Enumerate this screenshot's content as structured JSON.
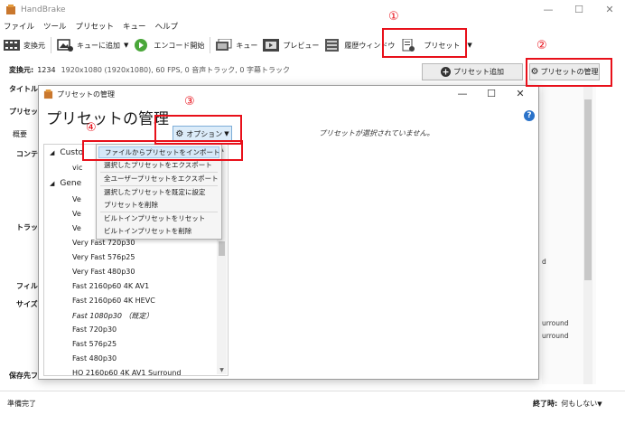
{
  "app": {
    "title": "HandBrake"
  },
  "menubar": [
    "ファイル",
    "ツール",
    "プリセット",
    "キュー",
    "ヘルプ"
  ],
  "toolbar": {
    "source": "変換元",
    "add_to_queue": "キューに追加",
    "start_encode": "エンコード開始",
    "queue": "キュー",
    "preview": "プレビュー",
    "activity_log": "履歴ウィンドウ",
    "presets": "プリセット"
  },
  "source_info": {
    "label": "変換元:",
    "name": "1234",
    "details": "1920x1080 (1920x1080), 60 FPS, 0 音声トラック, 0 字幕トラック"
  },
  "main_labels": {
    "title": "タイトル:",
    "preset": "プリセット:",
    "summary_tab": "概要",
    "content": "コンテナ",
    "tracks": "トラック",
    "filters": "フィルタ",
    "size": "サイズ:",
    "save_as": "保存先ファ"
  },
  "buttons": {
    "add_preset": "プリセット追加",
    "manage_presets": "プリセットの管理"
  },
  "right_panel": [
    "d",
    "urround",
    "urround"
  ],
  "status": {
    "text": "準備完了",
    "when_done_label": "終了時:",
    "when_done_value": "何もしない"
  },
  "dialog": {
    "window_title": "プリセットの管理",
    "heading": "プリセットの管理",
    "options_button": "オプション",
    "no_selection": "プリセットが選択されていません。",
    "groups": [
      "Custo",
      "Gene"
    ],
    "custom_items": [
      "vic"
    ],
    "general_items": [
      "Ve",
      "Ve",
      "Ve",
      "Very Fast 720p30",
      "Very Fast 576p25",
      "Very Fast 480p30",
      "Fast 2160p60 4K AV1",
      "Fast 2160p60 4K HEVC",
      "Fast 1080p30 （既定）",
      "Fast 720p30",
      "Fast 576p25",
      "Fast 480p30",
      "HQ 2160p60 4K AV1 Surround"
    ]
  },
  "options_menu": [
    "ファイルからプリセットをインポート",
    "選択したプリセットをエクスポート",
    "全ユーザープリセットをエクスポート",
    "選択したプリセットを既定に設定",
    "プリセットを削除",
    "ビルトインプリセットをリセット",
    "ビルトインプリセットを削除"
  ],
  "annotations": [
    "①",
    "②",
    "③",
    "④"
  ],
  "colors": {
    "annotation": "#e8101a",
    "accent": "#2a72c9",
    "menu_highlight": "#d6e8f8"
  },
  "icons": [
    "handbrake-icon",
    "source-film-icon",
    "add-queue-image-icon",
    "play-icon",
    "queue-icon",
    "preview-icon",
    "activity-log-icon",
    "presets-doc-icon",
    "plus-circle-icon",
    "gear-icon",
    "help-icon"
  ]
}
